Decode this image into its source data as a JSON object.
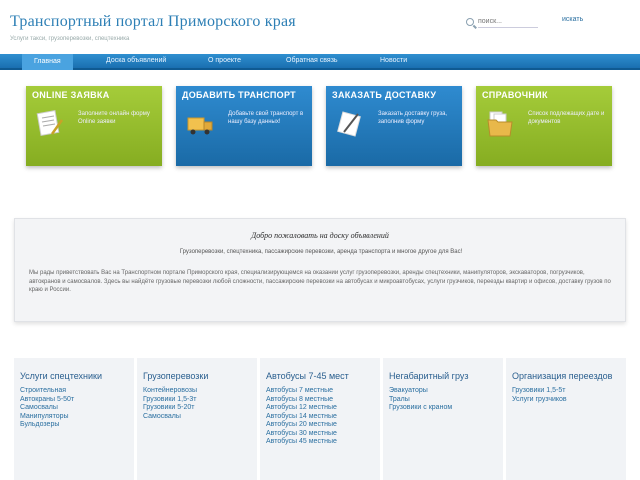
{
  "header": {
    "title": "Транспортный портал Приморского края",
    "subtitle": "Услуги такси, грузоперевозки, спецтехника",
    "search_placeholder": "поиск...",
    "search_button": "искать"
  },
  "nav": {
    "items": [
      {
        "label": "Главная"
      },
      {
        "label": "Доска объявлений"
      },
      {
        "label": "О проекте"
      },
      {
        "label": "Обратная связь"
      },
      {
        "label": "Новости"
      }
    ]
  },
  "promos": [
    {
      "title": "Online заявка",
      "text": "Заполните онлайн форму Online заявки",
      "color": "#96bd2c"
    },
    {
      "title": "Добавить транспорт",
      "text": "Добавьте свой транспорт в нашу базу данных!",
      "color": "#2479bd"
    },
    {
      "title": "Заказать доставку",
      "text": "Заказать доставку груза, заполнив форму",
      "color": "#2479bd"
    },
    {
      "title": "Справочник",
      "text": "Список подлежащих дате и документов",
      "color": "#96bd2c"
    }
  ],
  "info": {
    "heading": "Добро пожаловать на доску объявлений",
    "subheading": "Грузоперевозки, спецтехника, пассажирские перевозки, аренда транспорта и многое другое для Вас!",
    "body": "Мы рады приветствовать Вас на Транспортном портале Приморского края, специализирующемся на оказании услуг грузоперевозки, аренды спецтехники, манипуляторов, экскаваторов, погрузчиков, автокранов и самосвалов. Здесь вы найдёте грузовые перевозки любой сложности, пассажирские перевозки на автобусах и микроавтобусах, услуги грузчиков, переезды квартир и офисов, доставку грузов по краю и России."
  },
  "columns": [
    {
      "title": "Услуги спецтехники",
      "items": [
        "Строительная",
        "Автокраны 5-50т",
        "Самосвалы",
        "Манипуляторы",
        "Бульдозеры"
      ]
    },
    {
      "title": "Грузоперевозки",
      "items": [
        "Контейнеровозы",
        "Грузовики 1,5-3т",
        "Грузовики 5-20т",
        "Самосвалы"
      ]
    },
    {
      "title": "Автобусы 7-45 мест",
      "items": [
        "Автобусы 7 местные",
        "Автобусы 8 местные",
        "Автобусы 12 местные",
        "Автобусы 14 местные",
        "Автобусы 20 местные",
        "Автобусы 30 местные",
        "Автобусы 45 местные"
      ]
    },
    {
      "title": "Негабаритный груз",
      "items": [
        "Эвакуаторы",
        "Тралы",
        "Грузовики с краном"
      ]
    },
    {
      "title": "Организация переездов",
      "items": [
        "Грузовики 1,5-5т",
        "Услуги грузчиков"
      ]
    }
  ]
}
